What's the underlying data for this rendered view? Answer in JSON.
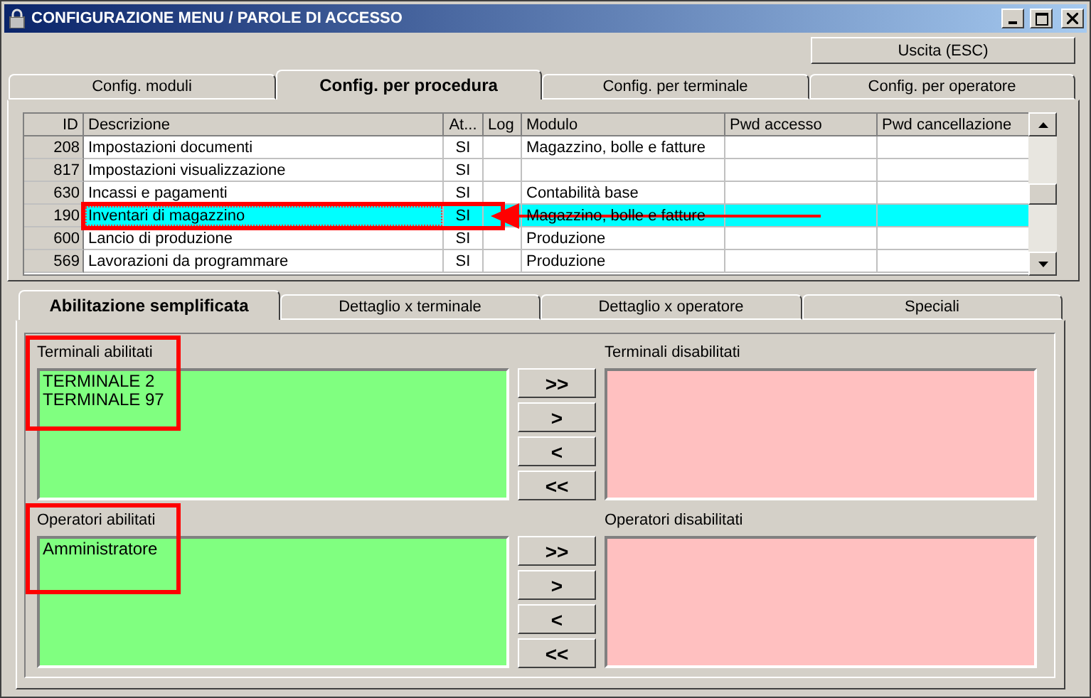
{
  "window": {
    "title": "CONFIGURAZIONE MENU / PAROLE DI ACCESSO"
  },
  "exit_button": "Uscita (ESC)",
  "tabs": [
    {
      "label": "Config. moduli",
      "selected": false
    },
    {
      "label": "Config. per procedura",
      "selected": true
    },
    {
      "label": "Config. per terminale",
      "selected": false
    },
    {
      "label": "Config. per operatore",
      "selected": false
    }
  ],
  "table": {
    "columns": [
      "ID",
      "Descrizione",
      "At...",
      "Log",
      "Modulo",
      "Pwd accesso",
      "Pwd cancellazione"
    ],
    "rows": [
      {
        "id": "208",
        "description": "Impostazioni documenti",
        "active": "SI",
        "module": "Magazzino, bolle e fatture",
        "selected": false,
        "annotated": false
      },
      {
        "id": "817",
        "description": "Impostazioni visualizzazione",
        "active": "SI",
        "selected": false,
        "annotated": false
      },
      {
        "id": "630",
        "description": "Incassi e pagamenti",
        "active": "SI",
        "module": "Contabilità base",
        "selected": false,
        "annotated": false
      },
      {
        "id": "190",
        "description": "Inventari di magazzino",
        "active": "SI",
        "module": "Magazzino, bolle e fatture",
        "selected": true,
        "annotated": true
      },
      {
        "id": "600",
        "description": "Lancio di produzione",
        "active": "SI",
        "module": "Produzione",
        "selected": false,
        "annotated": false
      },
      {
        "id": "569",
        "description": "Lavorazioni da programmare",
        "active": "SI",
        "module": "Produzione",
        "selected": false,
        "annotated": false
      }
    ]
  },
  "sub_tabs": [
    {
      "label": "Abilitazione semplificata",
      "selected": true
    },
    {
      "label": "Dettaglio x terminale",
      "selected": false
    },
    {
      "label": "Dettaglio x operatore",
      "selected": false
    },
    {
      "label": "Speciali",
      "selected": false
    }
  ],
  "sections": [
    {
      "enabled_label": "Terminali abilitati",
      "enabled_items": [
        "TERMINALE 2",
        "TERMINALE 97"
      ],
      "disabled_label": "Terminali disabilitati",
      "annotated": true,
      "buttons": [
        ">>",
        ">",
        "<",
        "<<"
      ]
    },
    {
      "enabled_label": "Operatori abilitati",
      "enabled_items": [
        "Amministratore"
      ],
      "disabled_label": "Operatori disabilitati",
      "annotated": true,
      "buttons": [
        ">>",
        ">",
        "<",
        "<<"
      ]
    }
  ]
}
